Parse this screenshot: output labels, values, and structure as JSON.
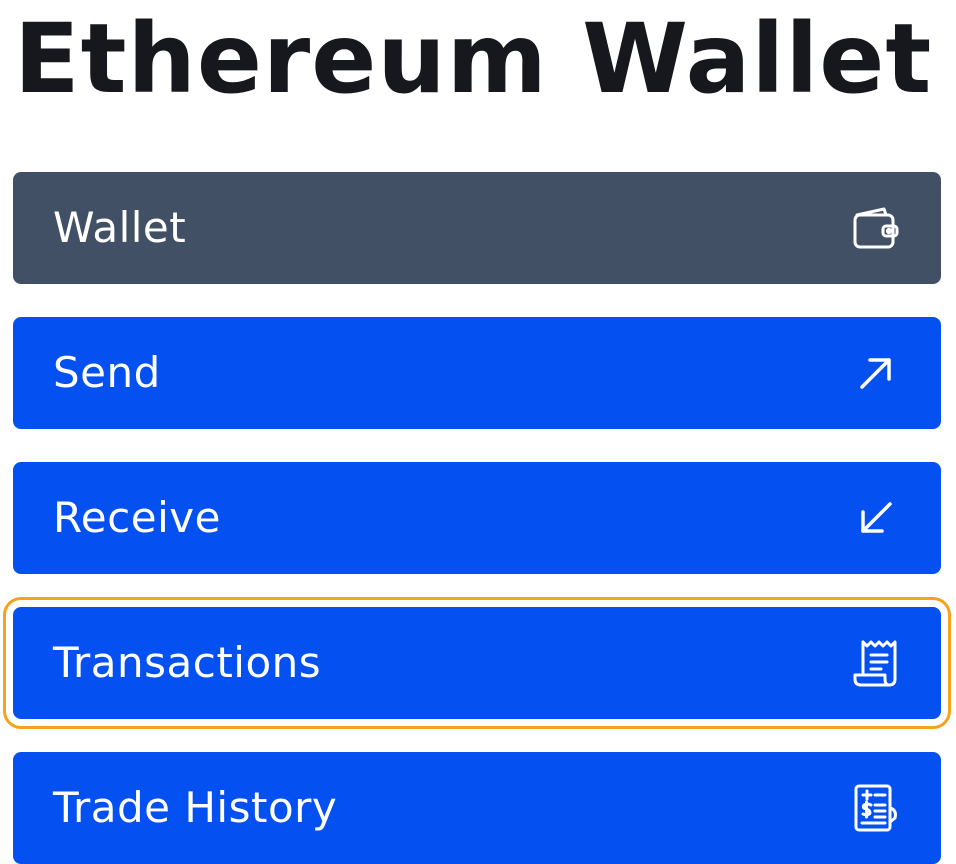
{
  "page": {
    "title": "Ethereum Wallet"
  },
  "menu": {
    "items": [
      {
        "label": "Wallet",
        "icon": "wallet-icon",
        "state": "selected"
      },
      {
        "label": "Send",
        "icon": "arrow-up-right-icon",
        "state": "normal"
      },
      {
        "label": "Receive",
        "icon": "arrow-down-left-icon",
        "state": "normal"
      },
      {
        "label": "Transactions",
        "icon": "receipt-icon",
        "state": "focused"
      },
      {
        "label": "Trade History",
        "icon": "ledger-icon",
        "state": "normal"
      }
    ]
  },
  "colors": {
    "primary": "#0550f0",
    "selected": "#425066",
    "focus_outline": "#f6a21c",
    "title_text": "#16181d",
    "button_text": "#ffffff"
  }
}
